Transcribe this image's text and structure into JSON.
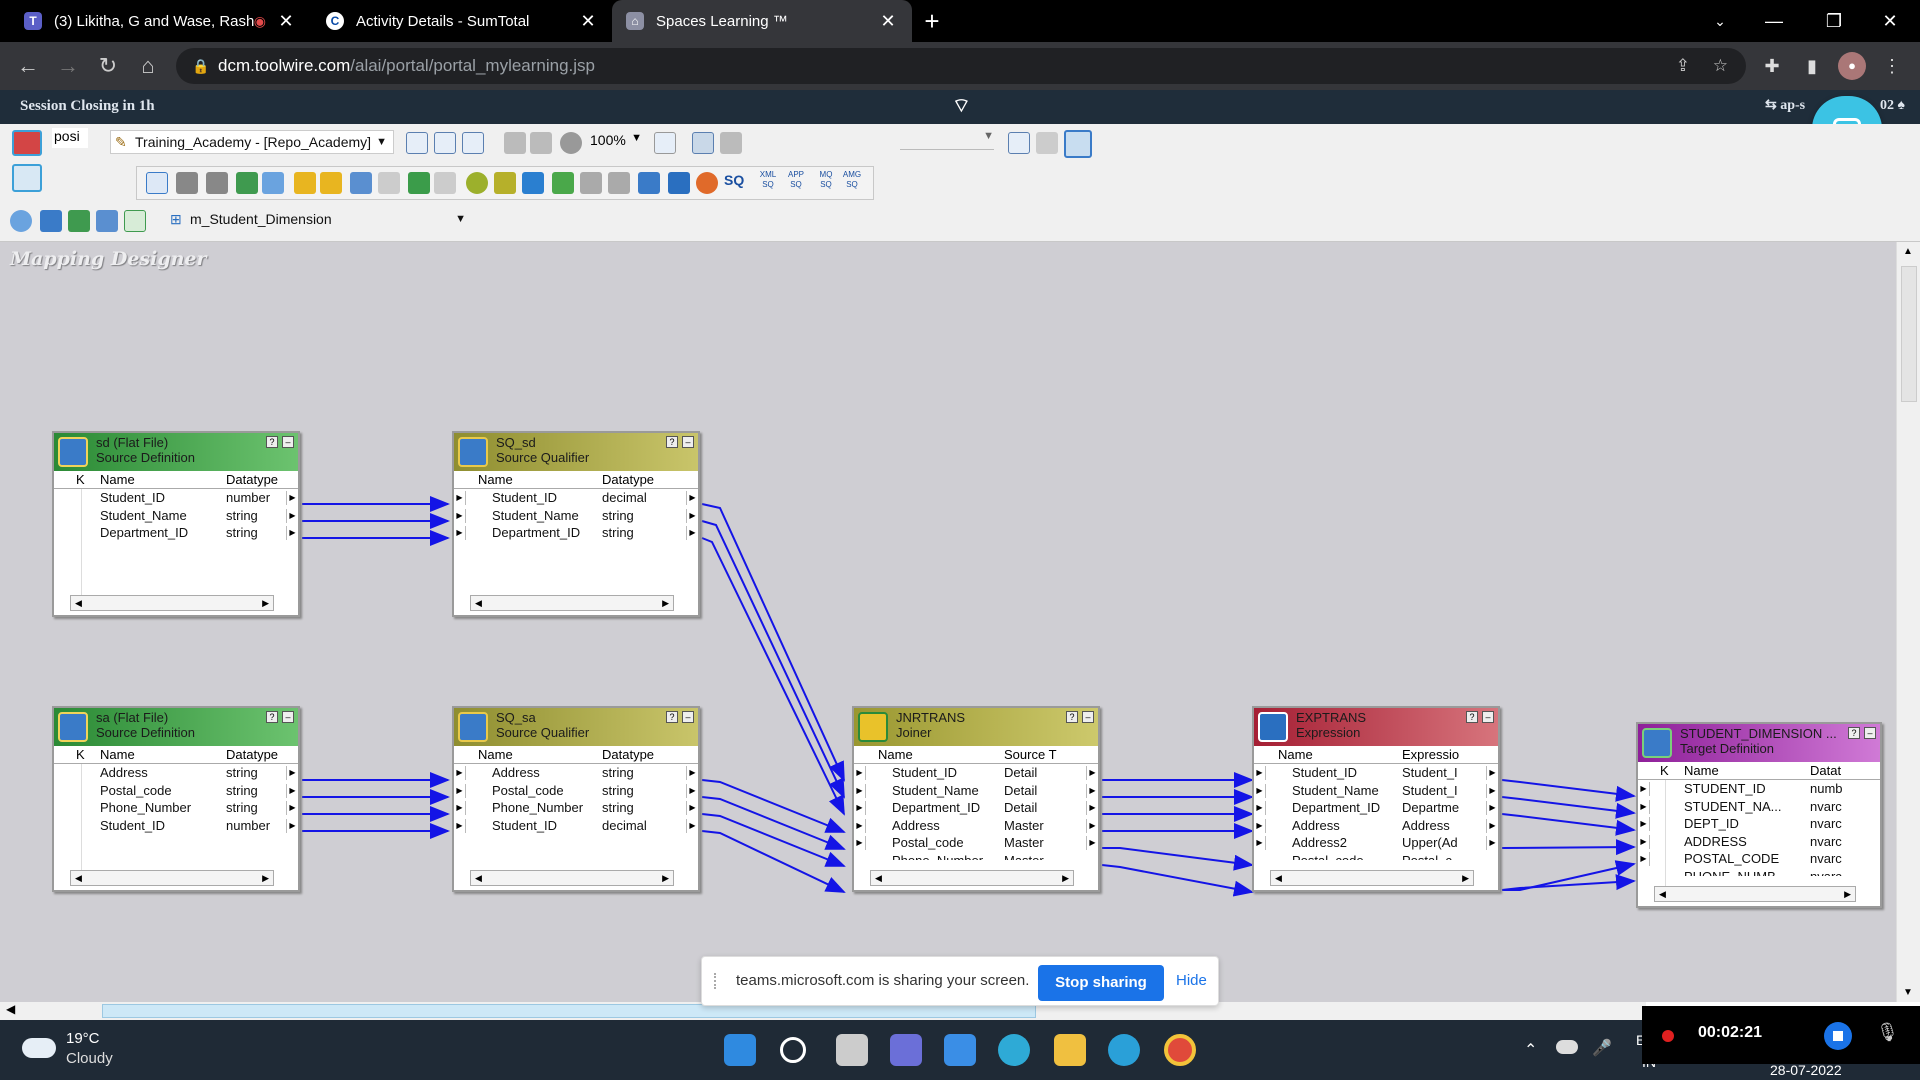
{
  "browser": {
    "tabs": [
      {
        "label": "(3) Likitha, G and Wase, Rash",
        "icon": "teams-icon"
      },
      {
        "label": "Activity Details - SumTotal",
        "icon": "sumtotal-icon"
      },
      {
        "label": "Spaces Learning ™",
        "icon": "spaces-icon"
      }
    ],
    "url_host": "dcm.toolwire.com",
    "url_path": "/alai/portal/portal_mylearning.jsp"
  },
  "session": {
    "banner": "Session Closing in 1h",
    "right_text": "⇆ ap-s",
    "right_tail": "02 ♠"
  },
  "toolbar": {
    "partial_text": "posi",
    "repository": "Training_Academy - [Repo_Academy]",
    "zoom": "100%",
    "mapping": "m_Student_Dimension",
    "sq_label": "SQ",
    "sq_small": [
      "XML SQ",
      "APP SQ",
      "MQ SQ",
      "AMG SQ"
    ]
  },
  "canvas": {
    "title": "Mapping Designer"
  },
  "transformations": {
    "sd": {
      "name": "sd (Flat File)",
      "type": "Source Definition",
      "columns": [
        "K",
        "Name",
        "Datatype"
      ],
      "rows": [
        [
          "Student_ID",
          "number"
        ],
        [
          "Student_Name",
          "string"
        ],
        [
          "Department_ID",
          "string"
        ]
      ]
    },
    "sq_sd": {
      "name": "SQ_sd",
      "type": "Source Qualifier",
      "columns": [
        "Name",
        "Datatype"
      ],
      "rows": [
        [
          "Student_ID",
          "decimal"
        ],
        [
          "Student_Name",
          "string"
        ],
        [
          "Department_ID",
          "string"
        ]
      ]
    },
    "sa": {
      "name": "sa (Flat File)",
      "type": "Source Definition",
      "columns": [
        "K",
        "Name",
        "Datatype"
      ],
      "rows": [
        [
          "Address",
          "string"
        ],
        [
          "Postal_code",
          "string"
        ],
        [
          "Phone_Number",
          "string"
        ],
        [
          "Student_ID",
          "number"
        ]
      ]
    },
    "sq_sa": {
      "name": "SQ_sa",
      "type": "Source Qualifier",
      "columns": [
        "Name",
        "Datatype"
      ],
      "rows": [
        [
          "Address",
          "string"
        ],
        [
          "Postal_code",
          "string"
        ],
        [
          "Phone_Number",
          "string"
        ],
        [
          "Student_ID",
          "decimal"
        ]
      ]
    },
    "joiner": {
      "name": "JNRTRANS",
      "type": "Joiner",
      "columns": [
        "Name",
        "Source T"
      ],
      "rows": [
        [
          "Student_ID",
          "Detail"
        ],
        [
          "Student_Name",
          "Detail"
        ],
        [
          "Department_ID",
          "Detail"
        ],
        [
          "Address",
          "Master"
        ],
        [
          "Postal_code",
          "Master"
        ],
        [
          "Phone_Number",
          "Master"
        ]
      ]
    },
    "expression": {
      "name": "EXPTRANS",
      "type": "Expression",
      "columns": [
        "Name",
        "Expressio"
      ],
      "rows": [
        [
          "Student_ID",
          "Student_I"
        ],
        [
          "Student_Name",
          "Student_I"
        ],
        [
          "Department_ID",
          "Departme"
        ],
        [
          "Address",
          "Address"
        ],
        [
          "Address2",
          "Upper(Ad"
        ],
        [
          "Postal_code",
          "Postal_c"
        ]
      ]
    },
    "target": {
      "name": "STUDENT_DIMENSION ...",
      "type": "Target Definition",
      "columns": [
        "K",
        "Name",
        "Datat"
      ],
      "rows": [
        [
          "STUDENT_ID",
          "numb"
        ],
        [
          "STUDENT_NA...",
          "nvarc"
        ],
        [
          "DEPT_ID",
          "nvarc"
        ],
        [
          "ADDRESS",
          "nvarc"
        ],
        [
          "POSTAL_CODE",
          "nvarc"
        ],
        [
          "PHONE_NUMB",
          "nvarc"
        ]
      ]
    }
  },
  "share_bar": {
    "message": "teams.microsoft.com is sharing your screen.",
    "stop_label": "Stop sharing",
    "hide_label": "Hide"
  },
  "taskbar": {
    "temperature": "19°C",
    "condition": "Cloudy",
    "lang_top": "EI",
    "lang_bottom": "IN",
    "date_partial": "28-07-2022"
  },
  "recording": {
    "timer": "00:02:21"
  },
  "colors": {
    "source_header": "#2e9b3a",
    "sq_header": "#a3a23c",
    "joiner_header": "#a9a63b",
    "expression_header": "#b8293a",
    "target_header": "#a12fa8",
    "link_color": "#1414e6"
  }
}
